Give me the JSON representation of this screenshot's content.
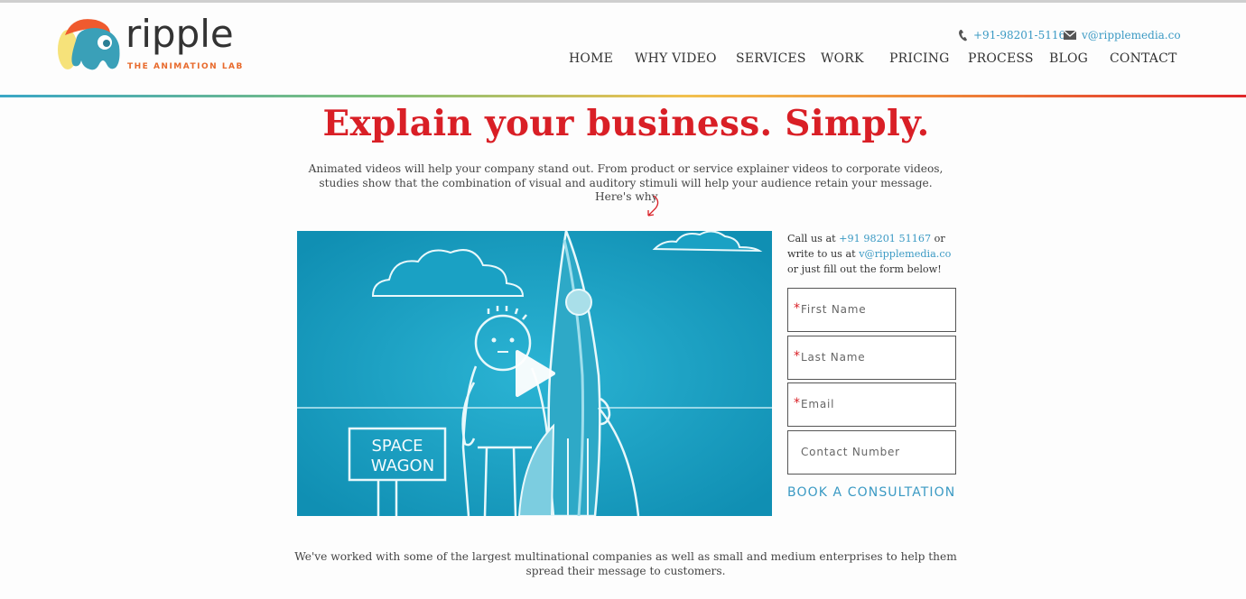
{
  "brand": {
    "name": "ripple",
    "tagline": "THE ANIMATION LAB",
    "colors": {
      "accent_red": "#d91f26",
      "link_blue": "#3b9ac4",
      "logo_orange": "#e86a2c",
      "logo_teal": "#3aa0b8",
      "logo_yellow": "#f6e27a"
    }
  },
  "header": {
    "phone": "+91-98201-51167",
    "phone_icon": "phone-icon",
    "email": "v@ripplemedia.co",
    "email_icon": "envelope-icon"
  },
  "nav": {
    "items": [
      {
        "label": "HOME"
      },
      {
        "label": "WHY VIDEO"
      },
      {
        "label": "SERVICES"
      },
      {
        "label": "WORK"
      },
      {
        "label": "PRICING"
      },
      {
        "label": "PROCESS"
      },
      {
        "label": "BLOG"
      },
      {
        "label": "CONTACT"
      }
    ]
  },
  "hero": {
    "headline": "Explain your business. Simply.",
    "intro": "Animated videos will help your company stand out. From product or service explainer videos to corporate videos, studies show that the combination of visual and auditory stimuli will help your audience retain your message.",
    "why": "Here's why"
  },
  "video": {
    "sign_line1": "SPACE",
    "sign_line2": "WAGON",
    "play_icon": "play-icon",
    "background_color": "#1aa6c7"
  },
  "contact_form": {
    "intro_prefix": "Call us at ",
    "phone": "+91 98201 51167",
    "intro_mid": " or write to us at ",
    "email": "v@ripplemedia.co",
    "intro_suffix": " or just fill out the form below!",
    "fields": [
      {
        "required": true,
        "placeholder": "First Name"
      },
      {
        "required": true,
        "placeholder": "Last Name"
      },
      {
        "required": true,
        "placeholder": "Email"
      },
      {
        "required": false,
        "placeholder": "Contact Number"
      }
    ],
    "required_mark": "*",
    "submit_label": "BOOK A CONSULTATION"
  },
  "footer_text": "We've worked with some of the largest multinational companies as well as small and medium enterprises to help them spread their message to customers."
}
